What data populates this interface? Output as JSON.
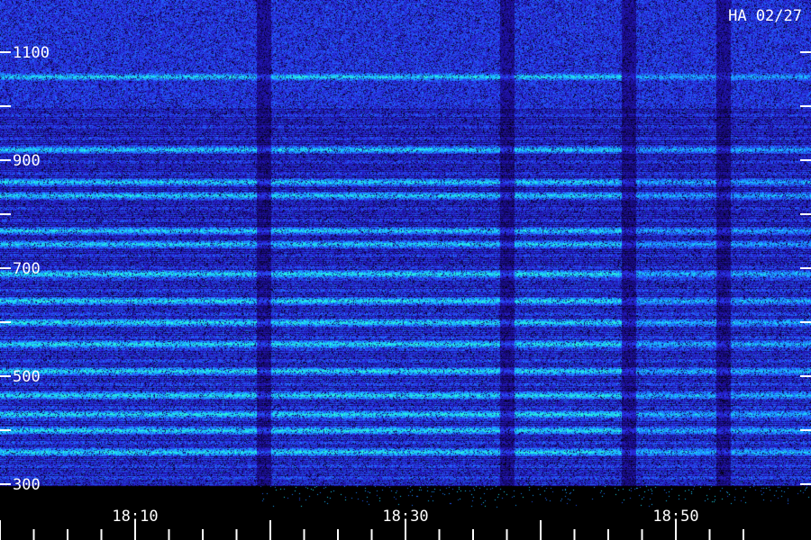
{
  "chart_data": {
    "type": "heatmap",
    "corner_label": "HA 02/27",
    "y_ticks": [
      300,
      400,
      500,
      600,
      700,
      800,
      900,
      1000,
      1100,
      1200
    ],
    "y_tick_labels": [
      "300",
      "500",
      "700",
      "900",
      "1100"
    ],
    "ylim": [
      300,
      1200
    ],
    "x_ticks": [
      "18:10",
      "18:30",
      "18:50"
    ],
    "x_minor_tick_minutes": 2.5,
    "xlim_minutes_after_1800": [
      -5,
      55
    ],
    "colormap": [
      "#000000",
      "#1a0a8c",
      "#2a2ae0",
      "#1f6fff",
      "#19c8ff",
      "#30ffd0"
    ],
    "dense_bands_hz": [
      1055,
      920,
      860,
      835,
      770,
      745,
      690,
      640,
      600,
      560,
      510,
      465,
      430,
      400,
      360
    ],
    "quiet_intervals": [
      "18:19-18:20",
      "18:37-18:38",
      "18:46-18:47",
      "18:53-18:54"
    ]
  }
}
